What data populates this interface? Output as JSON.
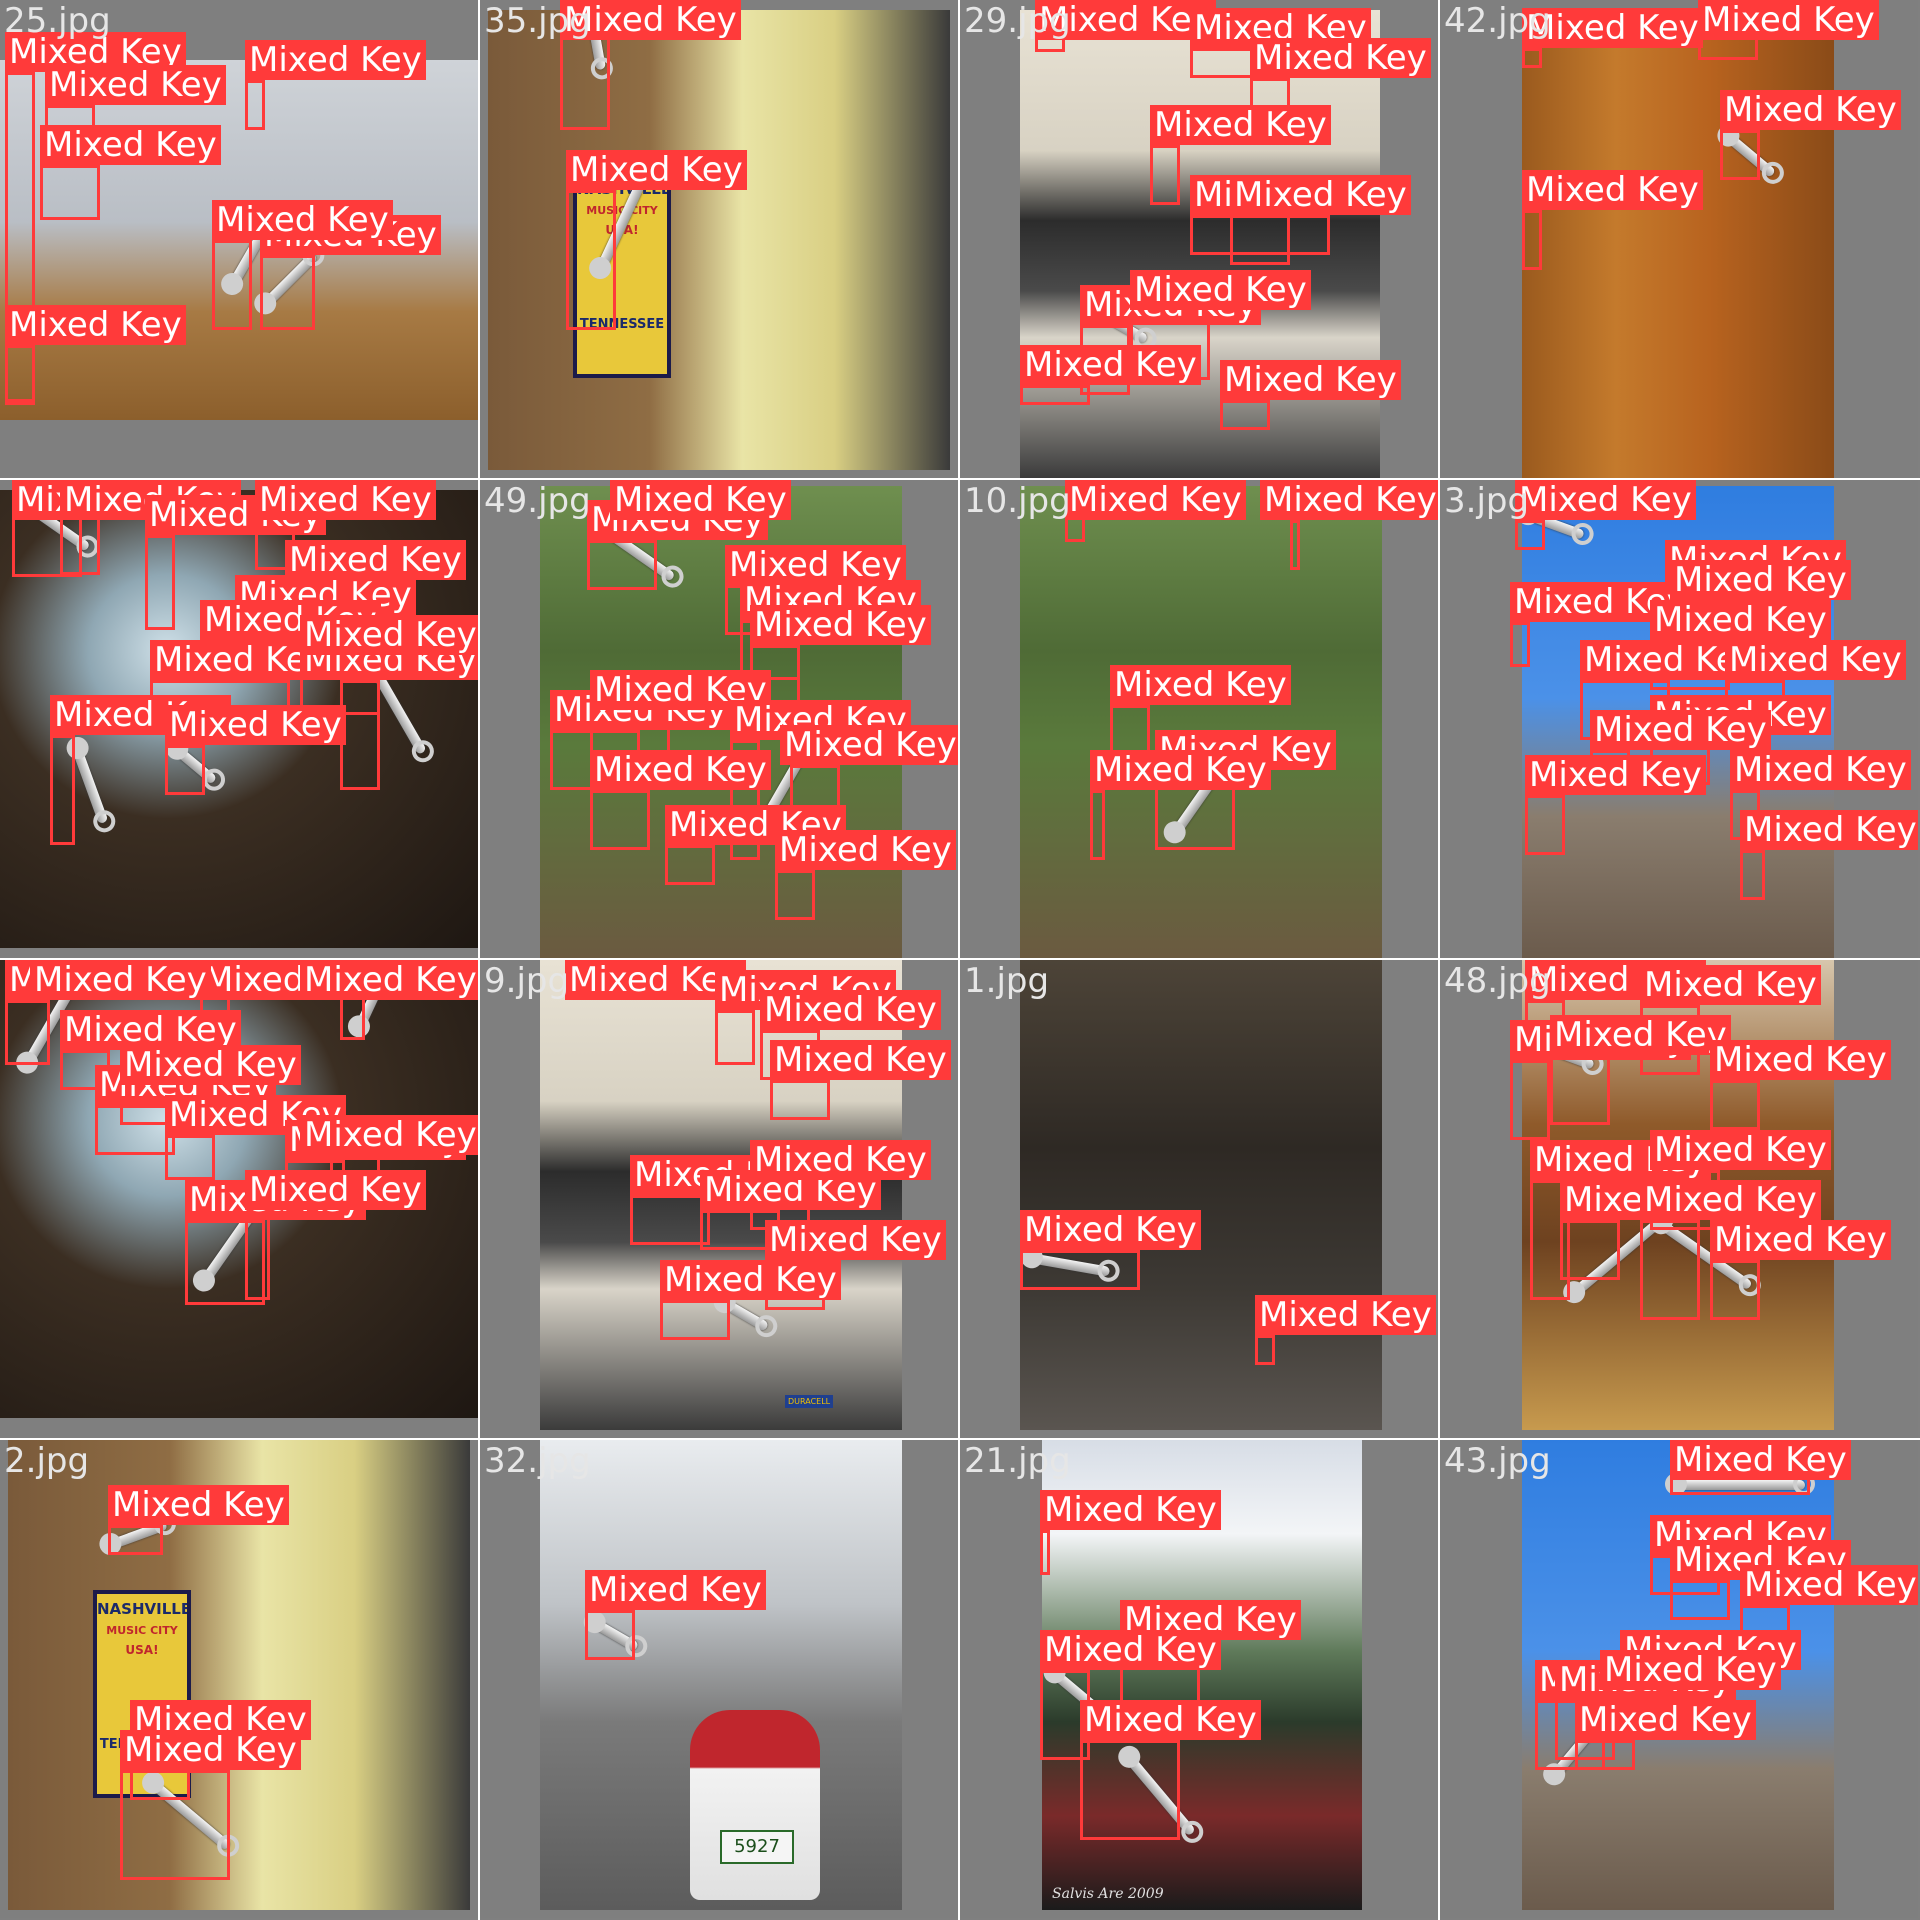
{
  "mosaic": {
    "label_text": "Mixed Key",
    "colors": {
      "box": "#ff3a3a",
      "label_text": "#ffffff",
      "filename": "#e6e6e6",
      "background": "#808080",
      "separator": "#ffffff"
    },
    "cells": [
      {
        "file": "25.jpg",
        "scene": "pegboard-workbench",
        "labels": 7
      },
      {
        "file": "35.jpg",
        "scene": "kitchen-nashville-poster",
        "labels": 2
      },
      {
        "file": "29.jpg",
        "scene": "electronics-shelves",
        "labels": 10
      },
      {
        "file": "42.jpg",
        "scene": "garden-tools-shed",
        "labels": 4
      },
      {
        "file": "",
        "scene": "dark-workshop-window",
        "labels": 12
      },
      {
        "file": "49.jpg",
        "scene": "forest-from-train",
        "labels": 12
      },
      {
        "file": "10.jpg",
        "scene": "forest-from-train",
        "labels": 5
      },
      {
        "file": "3.jpg",
        "scene": "clock-tower-sky",
        "labels": 12
      },
      {
        "file": "",
        "scene": "dark-workshop-window",
        "labels": 12
      },
      {
        "file": "9.jpg",
        "scene": "electronics-shelves",
        "labels": 9
      },
      {
        "file": "1.jpg",
        "scene": "crowded-repair-shop",
        "labels": 2
      },
      {
        "file": "48.jpg",
        "scene": "wooden-stairs-bicycles",
        "labels": 10
      },
      {
        "file": "2.jpg",
        "scene": "kitchen-nashville-poster",
        "labels": 3
      },
      {
        "file": "32.jpg",
        "scene": "scooter-street",
        "labels": 1
      },
      {
        "file": "21.jpg",
        "scene": "mountains-train",
        "labels": 4
      },
      {
        "file": "43.jpg",
        "scene": "clock-tower-sky",
        "labels": 9
      }
    ],
    "photo_text": {
      "poster_line1": "NASHVILLE",
      "poster_line2": "MUSIC CITY",
      "poster_line3": "USA!",
      "poster_line4": "TENNESSEE",
      "watermark": "Salvis Are 2009",
      "plate": "5927",
      "battery": "DURACELL"
    }
  }
}
